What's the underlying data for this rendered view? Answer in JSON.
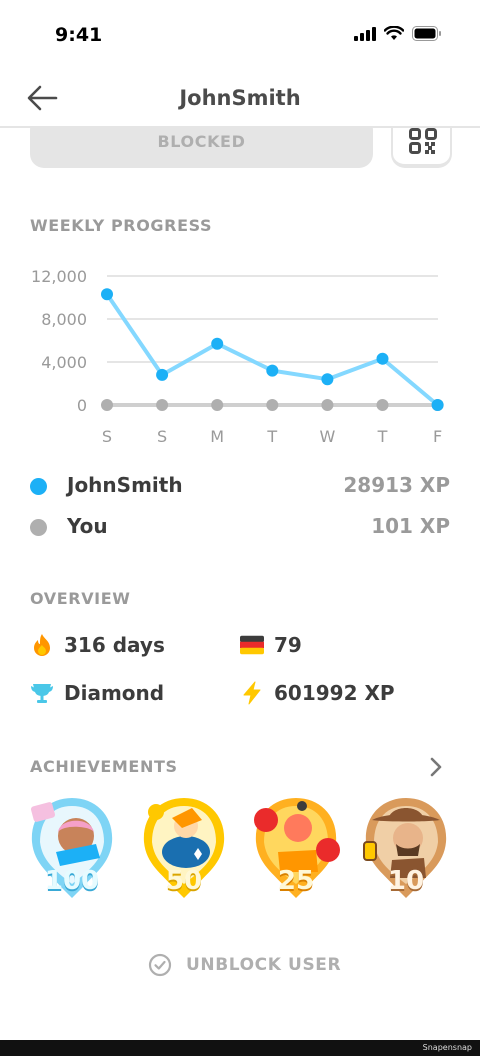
{
  "status": {
    "time": "9:41"
  },
  "header": {
    "title": "JohnSmith",
    "back_icon": "arrow-left-icon"
  },
  "actions": {
    "blocked_label": "BLOCKED",
    "qr_icon": "qr-code-icon"
  },
  "weekly": {
    "title": "WEEKLY PROGRESS",
    "chart_data": {
      "type": "line",
      "categories": [
        "S",
        "S",
        "M",
        "T",
        "W",
        "T",
        "F"
      ],
      "y_ticks": [
        "12,000",
        "8,000",
        "4,000",
        "0"
      ],
      "ylim": [
        0,
        12000
      ],
      "grid": true,
      "series": [
        {
          "name": "JohnSmith",
          "color": "#1cb0f6",
          "values": [
            10300,
            2800,
            5700,
            3200,
            2400,
            4300,
            0
          ]
        },
        {
          "name": "You",
          "color": "#afafaf",
          "values": [
            0,
            0,
            0,
            0,
            0,
            0,
            0
          ]
        }
      ]
    }
  },
  "legend": [
    {
      "name": "JohnSmith",
      "xp": "28913 XP",
      "color": "#1cb0f6"
    },
    {
      "name": "You",
      "xp": "101 XP",
      "color": "#afafaf"
    }
  ],
  "overview": {
    "title": "OVERVIEW",
    "streak": "316 days",
    "flag_count": "79",
    "league": "Diamond",
    "total_xp": "601992 XP"
  },
  "achievements": {
    "title": "ACHIEVEMENTS",
    "badges": [
      {
        "level": "100",
        "color": "#7ed4f5"
      },
      {
        "level": "50",
        "color": "#ffc800"
      },
      {
        "level": "25",
        "color": "#ffb020"
      },
      {
        "level": "10",
        "color": "#e0a060"
      }
    ]
  },
  "footer": {
    "unblock_label": "UNBLOCK USER",
    "watermark": "Snapensnap"
  }
}
